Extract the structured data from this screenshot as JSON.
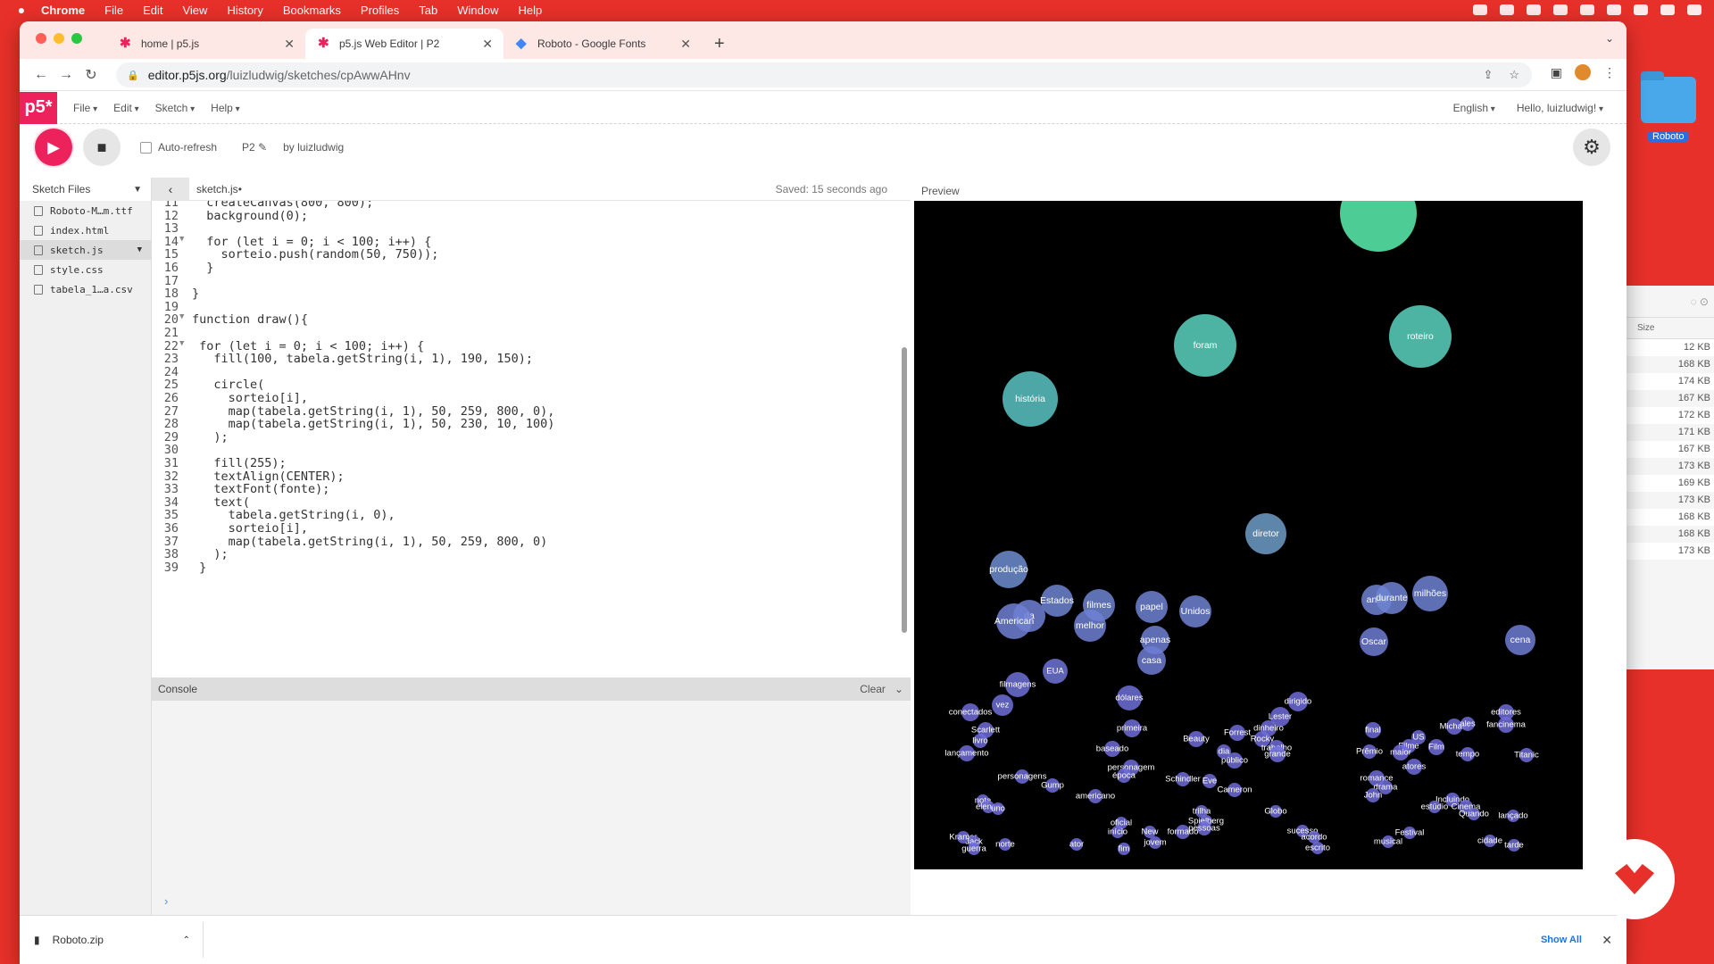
{
  "menubar": {
    "apple": "",
    "items": [
      "Chrome",
      "File",
      "Edit",
      "View",
      "History",
      "Bookmarks",
      "Profiles",
      "Tab",
      "Window",
      "Help"
    ]
  },
  "tabs": [
    {
      "title": "home | p5.js"
    },
    {
      "title": "p5.js Web Editor | P2"
    },
    {
      "title": "Roboto - Google Fonts"
    }
  ],
  "omnibox": {
    "host": "editor.p5js.org",
    "path": "/luizludwig/sketches/cpAwwAHnv"
  },
  "p5nav": {
    "logo": "p5*",
    "menus": [
      "File",
      "Edit",
      "Sketch",
      "Help"
    ],
    "language": "English",
    "greeting": "Hello, luizludwig!"
  },
  "p5tools": {
    "autorefresh": "Auto-refresh",
    "sketch_name": "P2",
    "by": "by luizludwig"
  },
  "sidebar": {
    "title": "Sketch Files",
    "files": [
      "Roboto-M…m.ttf",
      "index.html",
      "sketch.js",
      "style.css",
      "tabela_1…a.csv"
    ]
  },
  "editor": {
    "filename": "sketch.js",
    "saved": "Saved: 15 seconds ago",
    "lines": [
      {
        "n": "11",
        "text": "  createCanvas(800, 800);"
      },
      {
        "n": "12",
        "text": "  background(0);"
      },
      {
        "n": "13",
        "text": ""
      },
      {
        "n": "14",
        "text": "  for (let i = 0; i < 100; i++) {"
      },
      {
        "n": "15",
        "text": "    sorteio.push(random(50, 750));"
      },
      {
        "n": "16",
        "text": "  }"
      },
      {
        "n": "17",
        "text": ""
      },
      {
        "n": "18",
        "text": "}"
      },
      {
        "n": "19",
        "text": ""
      },
      {
        "n": "20",
        "text": "function draw(){"
      },
      {
        "n": "21",
        "text": ""
      },
      {
        "n": "22",
        "text": " for (let i = 0; i < 100; i++) {"
      },
      {
        "n": "23",
        "text": "   fill(100, tabela.getString(i, 1), 190, 150);"
      },
      {
        "n": "24",
        "text": ""
      },
      {
        "n": "25",
        "text": "   circle("
      },
      {
        "n": "26",
        "text": "     sorteio[i],"
      },
      {
        "n": "27",
        "text": "     map(tabela.getString(i, 1), 50, 259, 800, 0),"
      },
      {
        "n": "28",
        "text": "     map(tabela.getString(i, 1), 50, 230, 10, 100)"
      },
      {
        "n": "29",
        "text": "   );"
      },
      {
        "n": "30",
        "text": ""
      },
      {
        "n": "31",
        "text": "   fill(255);"
      },
      {
        "n": "32",
        "text": "   textAlign(CENTER);"
      },
      {
        "n": "33",
        "text": "   textFont(fonte);"
      },
      {
        "n": "34",
        "text": "   text("
      },
      {
        "n": "35",
        "text": "     tabela.getString(i, 0),"
      },
      {
        "n": "36",
        "text": "     sorteio[i],"
      },
      {
        "n": "37",
        "text": "     map(tabela.getString(i, 1), 50, 259, 800, 0)"
      },
      {
        "n": "38",
        "text": "   );"
      },
      {
        "n": "39",
        "text": " }"
      }
    ]
  },
  "console": {
    "title": "Console",
    "clear": "Clear",
    "prompt": "›"
  },
  "preview": {
    "label": "Preview",
    "words": [
      {
        "w": "",
        "c": "#5cf0b0"
      },
      {
        "w": "foram",
        "c": "#5ad2c0"
      },
      {
        "w": "roteiro",
        "c": "#5ad2c0"
      },
      {
        "w": "história",
        "c": "#5cc4c4"
      },
      {
        "w": "diretor",
        "c": "#6f9ec8"
      },
      {
        "w": "produção",
        "c": "#6e8ed0"
      },
      {
        "w": "Estados",
        "c": "#6e86d2"
      },
      {
        "w": "filmes",
        "c": "#6e86d2"
      },
      {
        "w": "da",
        "c": "#6e80d4"
      },
      {
        "w": "American",
        "c": "#6e80d4"
      },
      {
        "w": "melhor",
        "c": "#6e80d4"
      },
      {
        "w": "papel",
        "c": "#6e84d2"
      },
      {
        "w": "Unidos",
        "c": "#6e84d2"
      },
      {
        "w": "apenas",
        "c": "#6e80d4"
      },
      {
        "w": "casa",
        "c": "#6e7cd4"
      },
      {
        "w": "anos",
        "c": "#6e84d2"
      },
      {
        "w": "durante",
        "c": "#6e84d2"
      },
      {
        "w": "milhões",
        "c": "#6e84d2"
      },
      {
        "w": "Oscar",
        "c": "#6e7cd4"
      },
      {
        "w": "cena",
        "c": "#6e7cd4"
      },
      {
        "w": "EUA",
        "c": "#6e74d6"
      },
      {
        "w": "filmagens",
        "c": "#6e70d6"
      },
      {
        "w": "vez",
        "c": "#6e70d6"
      },
      {
        "w": "dólares",
        "c": "#6e70d6"
      },
      {
        "w": "dirigido",
        "c": "#6e6cd8"
      },
      {
        "w": "Lester",
        "c": "#6e6cd8"
      },
      {
        "w": "editores",
        "c": "#6e6cd8"
      },
      {
        "w": "conectados",
        "c": "#6e6cd8"
      },
      {
        "w": "fancinema",
        "c": "#6e6cd8"
      },
      {
        "w": "primeira",
        "c": "#6e6cd8"
      },
      {
        "w": "final",
        "c": "#6e6cd8"
      },
      {
        "w": "Michael",
        "c": "#6e6cd8"
      },
      {
        "w": "ales",
        "c": "#6e6cd8"
      },
      {
        "w": "Scarlett",
        "c": "#6e6cd8"
      },
      {
        "w": "livro",
        "c": "#6e6cd8"
      },
      {
        "w": "Forrest",
        "c": "#6e6cd8"
      },
      {
        "w": "dinheiro",
        "c": "#6e6cd8"
      },
      {
        "w": "Rocky",
        "c": "#6e6cd8"
      },
      {
        "w": "Beauty",
        "c": "#6e6cd8"
      },
      {
        "w": "US",
        "c": "#6e6cd8"
      },
      {
        "w": "Filme",
        "c": "#6e6cd8"
      },
      {
        "w": "Film",
        "c": "#6e6cd8"
      },
      {
        "w": "baseado",
        "c": "#6e6cd8"
      },
      {
        "w": "dia",
        "c": "#6e6cd8"
      },
      {
        "w": "trabalho",
        "c": "#6e6cd8"
      },
      {
        "w": "Prêmio",
        "c": "#6e6cd8"
      },
      {
        "w": "maior",
        "c": "#6e6cd8"
      },
      {
        "w": "lançamento",
        "c": "#6e6cd8"
      },
      {
        "w": "público",
        "c": "#6e6cd8"
      },
      {
        "w": "grande",
        "c": "#6e6cd8"
      },
      {
        "w": "tempo",
        "c": "#6e6cd8"
      },
      {
        "w": "Titanic",
        "c": "#6e6cd8"
      },
      {
        "w": "personagem",
        "c": "#6e6cd8"
      },
      {
        "w": "atores",
        "c": "#6e6cd8"
      },
      {
        "w": "romance",
        "c": "#6e6cd8"
      },
      {
        "w": "drama",
        "c": "#6e6cd8"
      },
      {
        "w": "personagens",
        "c": "#6e6cd8"
      },
      {
        "w": "época",
        "c": "#6e6cd8"
      },
      {
        "w": "Schindler",
        "c": "#6e6cd8"
      },
      {
        "w": "Eve",
        "c": "#6e6cd8"
      },
      {
        "w": "Gump",
        "c": "#6e6cd8"
      },
      {
        "w": "Cameron",
        "c": "#6e6cd8"
      },
      {
        "w": "John",
        "c": "#6e6cd8"
      },
      {
        "w": "americano",
        "c": "#6e6cd8"
      },
      {
        "w": "nota",
        "c": "#6e6cd8"
      },
      {
        "w": "Incluindo",
        "c": "#6e6cd8"
      },
      {
        "w": "elenco",
        "c": "#6e6cd8"
      },
      {
        "w": "uno",
        "c": "#6e6cd8"
      },
      {
        "w": "estúdio",
        "c": "#6e6cd8"
      },
      {
        "w": "Cinema",
        "c": "#6e6cd8"
      },
      {
        "w": "trilha",
        "c": "#6e6cd8"
      },
      {
        "w": "Quando",
        "c": "#6e6cd8"
      },
      {
        "w": "Globo",
        "c": "#6e6cd8"
      },
      {
        "w": "lançado",
        "c": "#6e6cd8"
      },
      {
        "w": "oficial",
        "c": "#6e6cd8"
      },
      {
        "w": "Spielberg",
        "c": "#6e6cd8"
      },
      {
        "w": "início",
        "c": "#6e6cd8"
      },
      {
        "w": "New",
        "c": "#6e6cd8"
      },
      {
        "w": "formado",
        "c": "#6e6cd8"
      },
      {
        "w": "pessoas",
        "c": "#6e6cd8"
      },
      {
        "w": "sucesso",
        "c": "#6e6cd8"
      },
      {
        "w": "Kramer",
        "c": "#6e6cd8"
      },
      {
        "w": "Festival",
        "c": "#6e6cd8"
      },
      {
        "w": "Jack",
        "c": "#6e6cd8"
      },
      {
        "w": "norte",
        "c": "#6e6cd8"
      },
      {
        "w": "ator",
        "c": "#6e6cd8"
      },
      {
        "w": "jovem",
        "c": "#6e6cd8"
      },
      {
        "w": "acordo",
        "c": "#6e6cd8"
      },
      {
        "w": "musical",
        "c": "#6e6cd8"
      },
      {
        "w": "cidade",
        "c": "#6e6cd8"
      },
      {
        "w": "guerra",
        "c": "#6e6cd8"
      },
      {
        "w": "fim",
        "c": "#6e6cd8"
      },
      {
        "w": "escrito",
        "c": "#6e6cd8"
      },
      {
        "w": "tarde",
        "c": "#6e6cd8"
      }
    ]
  },
  "download": {
    "file": "Roboto.zip",
    "show_all": "Show All"
  },
  "desktop": {
    "folder": "Roboto"
  },
  "finder": {
    "size_header": "Size",
    "sizes": [
      "12 KB",
      "168 KB",
      "174 KB",
      "167 KB",
      "172 KB",
      "171 KB",
      "167 KB",
      "173 KB",
      "169 KB",
      "173 KB",
      "168 KB",
      "168 KB",
      "173 KB"
    ]
  },
  "colors": {
    "p5_pink": "#ed225d",
    "wallpaper": "#e8302a"
  }
}
